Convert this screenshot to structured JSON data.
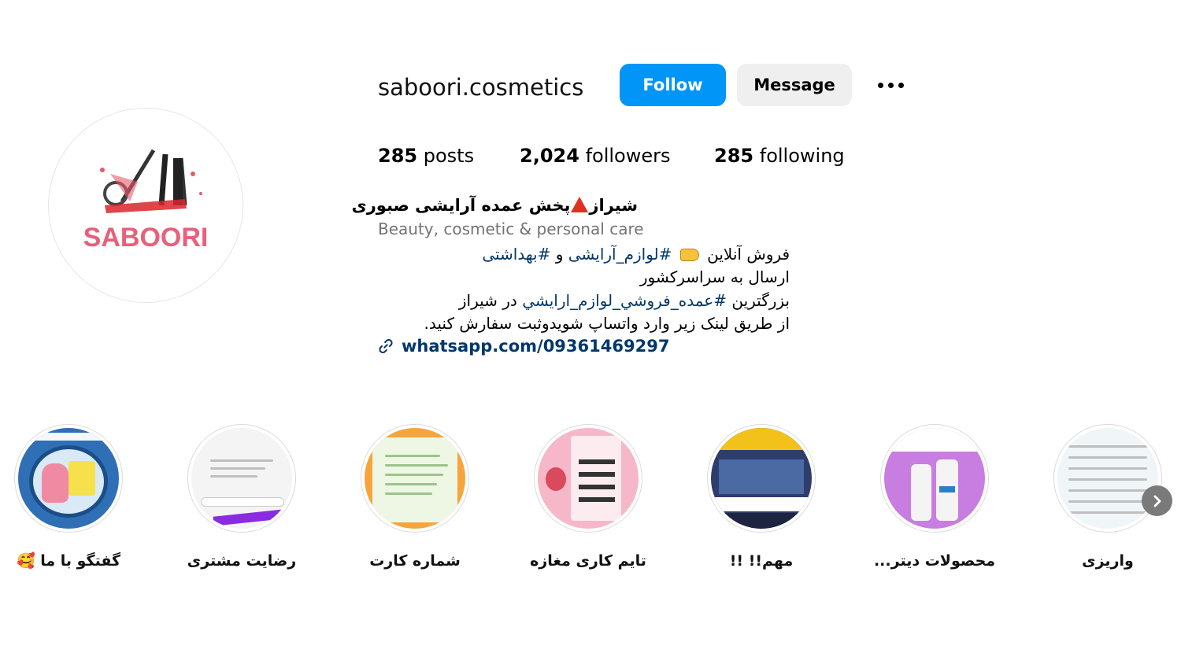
{
  "profile": {
    "username": "saboori.cosmetics",
    "avatar_text": "SABOORI",
    "follow_label": "Follow",
    "message_label": "Message",
    "more_icon": "more-options-icon"
  },
  "stats": {
    "posts_count": "285",
    "posts_label": "posts",
    "followers_count": "2,024",
    "followers_label": "followers",
    "following_count": "285",
    "following_label": "following"
  },
  "bio": {
    "name_part1": "شیراز",
    "name_part2": "پخش عمده آرایشی صبوری",
    "category": "Beauty, cosmetic & personal care",
    "line1_text": "فروش آنلاین",
    "line1_tag1": "#لوازم_آرایشی",
    "line1_and": "و",
    "line1_tag2": "#بهداشتی",
    "line2": "ارسال به سراسرکشور",
    "line3_text": "بزرگترین",
    "line3_tag": "#عمده_فروشي_لوازم_ارايشي",
    "line3_end": "در شیراز",
    "line4": "از طریق لینک زیر وارد واتساپ شویدوثبت سفارش کنید.",
    "link": "whatsapp.com/09361469297"
  },
  "highlights": [
    {
      "label": "گفتگو با ما 🥰",
      "color": "#2f6fb5"
    },
    {
      "label": "رضایت مشتری",
      "color": "#f4f4f4"
    },
    {
      "label": "شماره کارت",
      "color": "#f7a43c"
    },
    {
      "label": "تایم کاری مغازه",
      "color": "#f6b8c9"
    },
    {
      "label": "مهم!! !!",
      "color": "#2e3d6b"
    },
    {
      "label": "محصولات دیتر...",
      "color": "#c87de0"
    },
    {
      "label": "واریزی",
      "color": "#f0f5f7"
    }
  ],
  "colors": {
    "accent": "#0095f6",
    "link": "#00376b",
    "secondary_text": "#737373"
  }
}
